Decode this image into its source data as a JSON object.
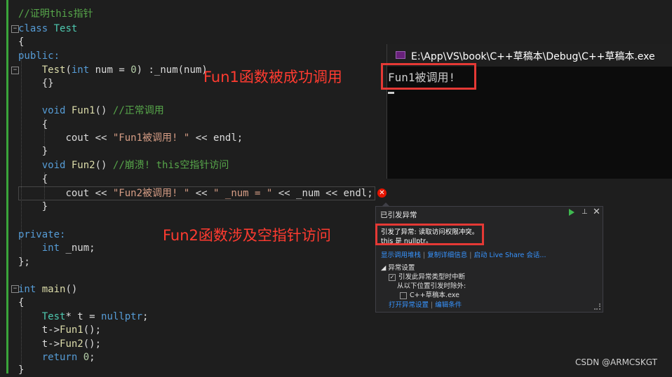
{
  "code": {
    "l1": {
      "c": "//证明this指针"
    },
    "l2": {
      "kw": "class",
      "name": "Test"
    },
    "l3": "{",
    "l4": "public:",
    "l5": {
      "fn": "Test",
      "p1": "(",
      "kw": "int",
      "p2": " num = ",
      "num": "0",
      "p3": ") :_num(num)"
    },
    "l6": "{}",
    "l8": {
      "kw": "void",
      "fn": "Fun1",
      "p": "() ",
      "c": "//正常调用"
    },
    "l9": "{",
    "l10": {
      "a": "cout << ",
      "s": "\"Fun1被调用! \"",
      "b": " << endl;"
    },
    "l11": "}",
    "l12": {
      "kw": "void",
      "fn": "Fun2",
      "p": "() ",
      "c": "//崩溃! this空指针访问"
    },
    "l13": "{",
    "l14": {
      "a": "cout << ",
      "s1": "\"Fun2被调用! \"",
      "b": " << ",
      "s2": "\" _num = \"",
      "c": " << _num << endl;"
    },
    "l15": "}",
    "l17": "private:",
    "l18": {
      "kw": "int",
      "v": " _num;"
    },
    "l19": "};",
    "l21": {
      "kw": "int",
      "fn": "main",
      "p": "()"
    },
    "l22": "{",
    "l23": {
      "ty": "Test",
      "a": "* t = ",
      "kw": "nullptr",
      "b": ";"
    },
    "l24": {
      "a": "t->",
      "fn": "Fun1",
      "b": "();"
    },
    "l25": {
      "a": "t->",
      "fn": "Fun2",
      "b": "();"
    },
    "l26": {
      "kw": "return",
      "num": " 0",
      "b": ";"
    },
    "l27": "}"
  },
  "console": {
    "title": "E:\\App\\VS\\book\\C++草稿本\\Debug\\C++草稿本.exe",
    "output": "Fun1被调用!"
  },
  "annotations": {
    "fun1": "Fun1函数被成功调用",
    "fun2": "Fun2函数涉及空指针访问"
  },
  "exception": {
    "title": "已引发异常",
    "msg1": "引发了异常: 读取访问权限冲突。",
    "msg2": "this 是 nullptr。",
    "link1": "显示调用堆栈",
    "link2": "复制详细信息",
    "link3": "启动 Live Share 会话...",
    "section": "异常设置",
    "opt1": "引发此异常类型时中断",
    "opt2": "从以下位置引发时除外:",
    "opt3": "C++草稿本.exe",
    "foot1": "打开异常设置",
    "foot2": "编辑条件"
  },
  "watermark": "CSDN @ARMCSKGT",
  "colors": {
    "gutter_bar": "#3aa43a",
    "annotation": "#ff3b30",
    "link": "#3794ff",
    "error": "#e51400"
  }
}
